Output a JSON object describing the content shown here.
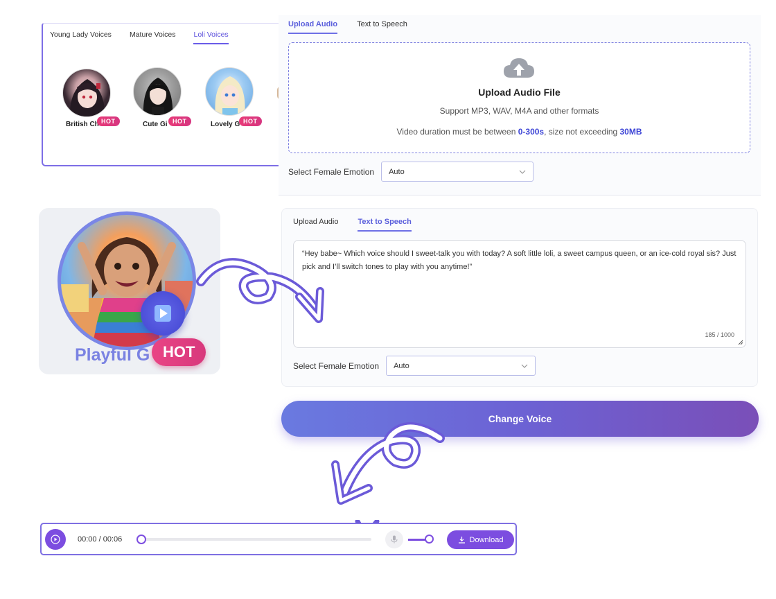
{
  "voice_selector": {
    "tabs": [
      "Young Lady Voices",
      "Mature Voices",
      "Loli Voices"
    ],
    "active_tab": "Loli Voices",
    "voices": [
      {
        "name": "British Ch",
        "badge": "HOT"
      },
      {
        "name": "Cute Gi",
        "badge": "HOT"
      },
      {
        "name": "Lovely G",
        "badge": "HOT"
      }
    ]
  },
  "featured_voice": {
    "name": "Playful G",
    "badge": "HOT",
    "icon": "play-icon"
  },
  "upload_panel": {
    "tabs": [
      "Upload Audio",
      "Text to Speech"
    ],
    "active_tab": "Upload Audio",
    "dropzone": {
      "icon": "cloud-upload-icon",
      "title": "Upload Audio File",
      "formats": "Support MP3, WAV, M4A and other formats",
      "limit_prefix": "Video duration must be between ",
      "limit_duration": "0-300s",
      "limit_middle": ", size not exceeding ",
      "limit_size": "30MB"
    },
    "emotion_label": "Select Female Emotion",
    "emotion_value": "Auto"
  },
  "tts_panel": {
    "tabs": [
      "Upload Audio",
      "Text to Speech"
    ],
    "active_tab": "Text to Speech",
    "text": "“Hey babe~ Which voice should I sweet-talk you with today? A soft little loli, a sweet campus queen, or an ice-cold royal sis? Just pick and I’ll switch tones to play with you anytime!”",
    "char_count": "185 / 1000",
    "emotion_label": "Select Female Emotion",
    "emotion_value": "Auto"
  },
  "change_voice_button": "Change Voice",
  "player": {
    "time": "00:00 / 00:06",
    "progress": 0,
    "volume": 0.7,
    "download_label": "Download"
  },
  "colors": {
    "accent": "#6a5ce8",
    "hot": "#e23b7c",
    "player_accent": "#7c4de0",
    "highlight_text": "#3d45d6"
  }
}
